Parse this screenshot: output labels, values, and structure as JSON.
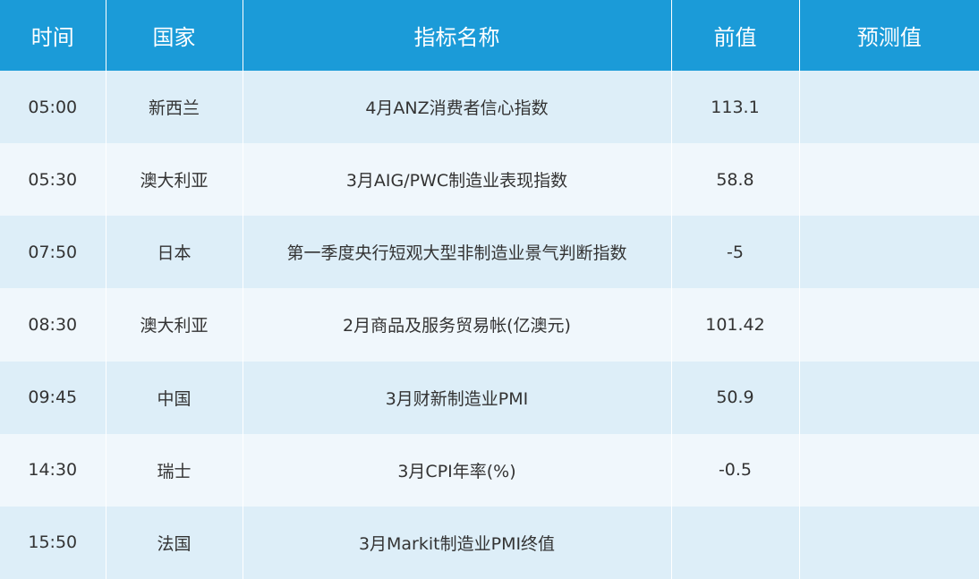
{
  "table": {
    "headers": [
      "时间",
      "国家",
      "指标名称",
      "前值",
      "预测值"
    ],
    "rows": [
      {
        "time": "05:00",
        "country": "新西兰",
        "indicator": "4月ANZ消费者信心指数",
        "previous": "113.1",
        "forecast": ""
      },
      {
        "time": "05:30",
        "country": "澳大利亚",
        "indicator": "3月AIG/PWC制造业表现指数",
        "previous": "58.8",
        "forecast": ""
      },
      {
        "time": "07:50",
        "country": "日本",
        "indicator": "第一季度央行短观大型非制造业景气判断指数",
        "previous": "-5",
        "forecast": ""
      },
      {
        "time": "08:30",
        "country": "澳大利亚",
        "indicator": "2月商品及服务贸易帐(亿澳元)",
        "previous": "101.42",
        "forecast": ""
      },
      {
        "time": "09:45",
        "country": "中国",
        "indicator": "3月财新制造业PMI",
        "previous": "50.9",
        "forecast": ""
      },
      {
        "time": "14:30",
        "country": "瑞士",
        "indicator": "3月CPI年率(%)",
        "previous": "-0.5",
        "forecast": ""
      },
      {
        "time": "15:50",
        "country": "法国",
        "indicator": "3月Markit制造业PMI终值",
        "previous": "",
        "forecast": ""
      }
    ]
  },
  "colors": {
    "header_bg": "#1b9bd8",
    "header_text": "#ffffff",
    "row_odd": "#ddeef8",
    "row_even": "#f0f7fc",
    "cell_text": "#333333"
  }
}
